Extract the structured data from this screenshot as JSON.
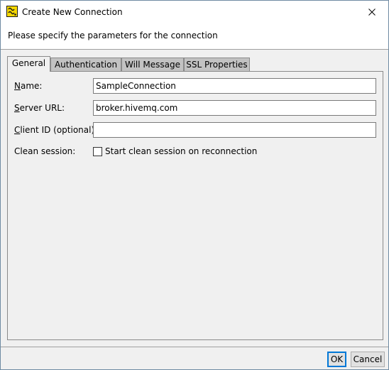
{
  "window": {
    "title": "Create New Connection",
    "app_icon": "hive-app-icon",
    "close_icon": "close-icon"
  },
  "banner": {
    "text": "Please specify the parameters for the connection"
  },
  "tabs": [
    {
      "label": "General",
      "active": true
    },
    {
      "label": "Authentication",
      "active": false
    },
    {
      "label": "Will Message",
      "active": false
    },
    {
      "label": "SSL Properties",
      "active": false
    }
  ],
  "form": {
    "name": {
      "mnemonic": "N",
      "rest": "ame:",
      "value": "SampleConnection"
    },
    "server_url": {
      "mnemonic": "S",
      "rest": "erver URL:",
      "value": "broker.hivemq.com"
    },
    "client_id": {
      "mnemonic": "C",
      "rest": "lient ID (optional):",
      "value": ""
    },
    "clean_session": {
      "label": "Clean session:",
      "checkbox_label": "Start clean session on reconnection",
      "checked": false
    }
  },
  "buttons": {
    "ok": "OK",
    "cancel": "Cancel"
  },
  "colors": {
    "accent": "#0078d7",
    "tab_inactive": "#c2c2c2",
    "dialog_bg": "#f0f0f0"
  }
}
